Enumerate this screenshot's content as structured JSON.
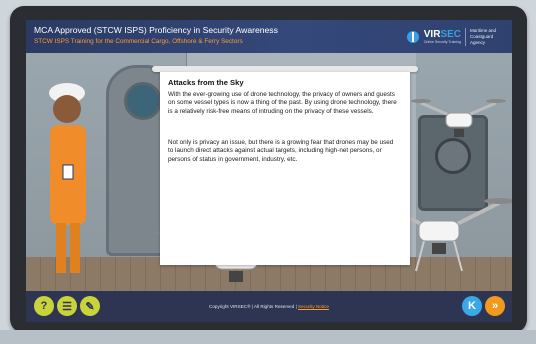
{
  "header": {
    "title": "MCA Approved (STCW ISPS) Proficiency in Security Awareness",
    "subtitle": "STCW ISPS Training for the Commercial Cargo, Offshore & Ferry Sectors",
    "brand_name_a": "VIR",
    "brand_name_b": "SEC",
    "brand_tagline": "Online Security Training",
    "partner_line1": "Maritime and",
    "partner_line2": "Coastguard Agency"
  },
  "slide": {
    "heading": "Attacks from the Sky",
    "paragraph1": "With the ever-growing use of drone technology, the privacy of owners and guests on some vessel types is now a thing of the past. By using drone technology, there is a relatively risk-free means of intruding on the privacy of these vessels.",
    "paragraph2": "Not only is privacy an issue, but there is a growing fear that drones may be used to launch direct attacks against actual targets, including high-net persons, or persons of status in government, industry, etc."
  },
  "footer": {
    "help_label": "?",
    "menu_label": "☰",
    "notes_label": "✎",
    "copyright": "Copyright VIRSEC® | All Rights Reserved |",
    "security_notice": "Security Notice",
    "back_label": "K",
    "next_label": "»"
  },
  "icons": {
    "help": "help-icon",
    "menu": "menu-icon",
    "notes": "notes-icon",
    "back": "back-icon",
    "next": "next-icon"
  }
}
